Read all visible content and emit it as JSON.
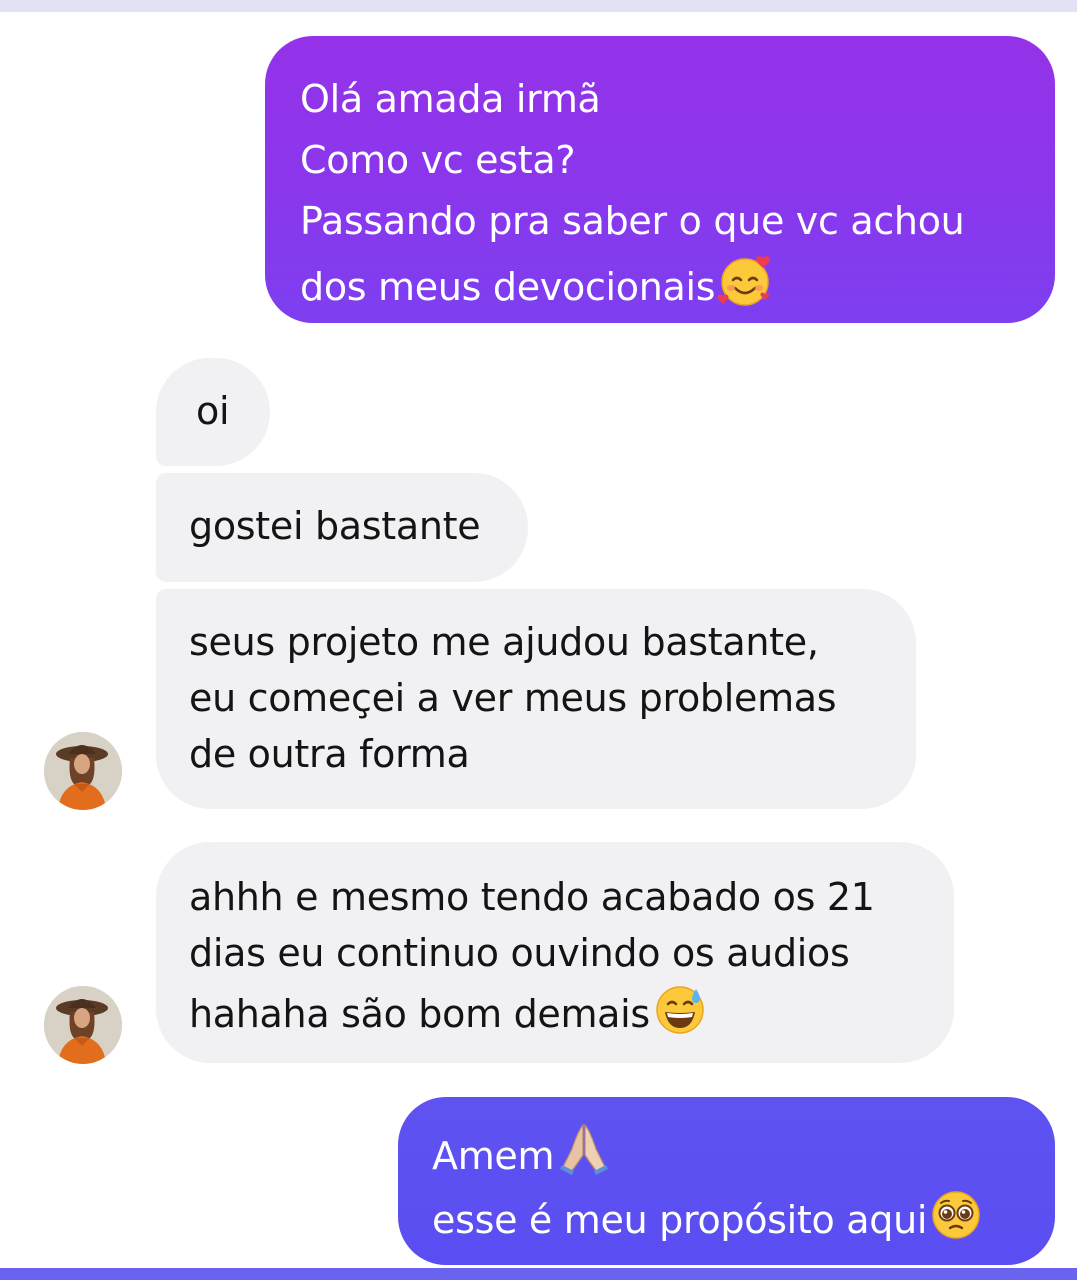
{
  "chat": {
    "messages": [
      {
        "direction": "outgoing",
        "lines": [
          "Olá amada irmã",
          "Como vc esta?",
          "Passando pra saber o que vc achou",
          "dos meus devocionais"
        ],
        "trailing_emoji": "smiling-face-with-hearts"
      },
      {
        "direction": "incoming",
        "lines": [
          "oi"
        ]
      },
      {
        "direction": "incoming",
        "lines": [
          "gostei bastante"
        ]
      },
      {
        "direction": "incoming",
        "lines": [
          "seus projeto me ajudou bastante,",
          "eu começei a ver meus problemas",
          "de outra forma"
        ],
        "avatar": "contact-avatar"
      },
      {
        "direction": "incoming",
        "lines": [
          "ahhh e mesmo tendo acabado os 21",
          "dias eu continuo ouvindo os audios",
          "hahaha são bom demais"
        ],
        "trailing_emoji": "grinning-face-with-sweat",
        "avatar": "contact-avatar"
      },
      {
        "direction": "outgoing",
        "lines": [
          "Amem",
          "esse é meu propósito aqui"
        ],
        "line_emojis": [
          "folded-hands",
          "pleading-face"
        ]
      }
    ]
  },
  "colors": {
    "outgoing_bubble_1": "#8a37ec",
    "outgoing_bubble_2": "#5a4ef3",
    "incoming_bubble": "#f1f1f4",
    "top_strip": "#e3e2f4",
    "bottom_strip": "#6a63f0"
  }
}
